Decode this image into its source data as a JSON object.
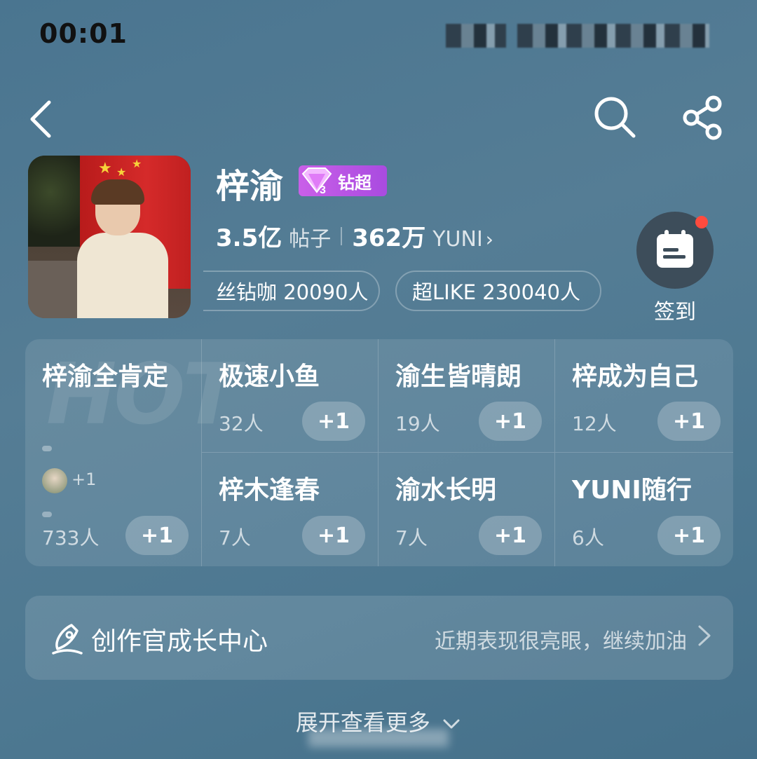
{
  "status_bar": {
    "time": "00:01"
  },
  "profile": {
    "name": "梓渝",
    "badge_label": "钻超",
    "posts_count": "3.5亿",
    "posts_label": "帖子",
    "members_count": "362万",
    "members_label": "YUNI",
    "fans_pill": "丝钻咖 20090人",
    "like_pill": "超LIKE 230040人",
    "checkin_label": "签到"
  },
  "hot_list": {
    "hot_watermark": "HOT",
    "featured": {
      "title": "梓渝全肯定",
      "count": "733人",
      "plus": "+1",
      "mini_plus": "+1"
    },
    "items": [
      {
        "title": "极速小鱼",
        "count": "32人",
        "plus": "+1"
      },
      {
        "title": "渝生皆晴朗",
        "count": "19人",
        "plus": "+1"
      },
      {
        "title": "梓成为自己",
        "count": "12人",
        "plus": "+1"
      },
      {
        "title": "梓木逢春",
        "count": "7人",
        "plus": "+1"
      },
      {
        "title": "渝水长明",
        "count": "7人",
        "plus": "+1"
      },
      {
        "title": "YUNI随行",
        "count": "6人",
        "plus": "+1"
      }
    ]
  },
  "growth_center": {
    "title": "创作官成长中心",
    "subtitle": "近期表现很亮眼，继续加油"
  },
  "expand_label": "展开查看更多",
  "colors": {
    "badge": "#b955e4",
    "notification_dot": "#ff4b3e"
  }
}
